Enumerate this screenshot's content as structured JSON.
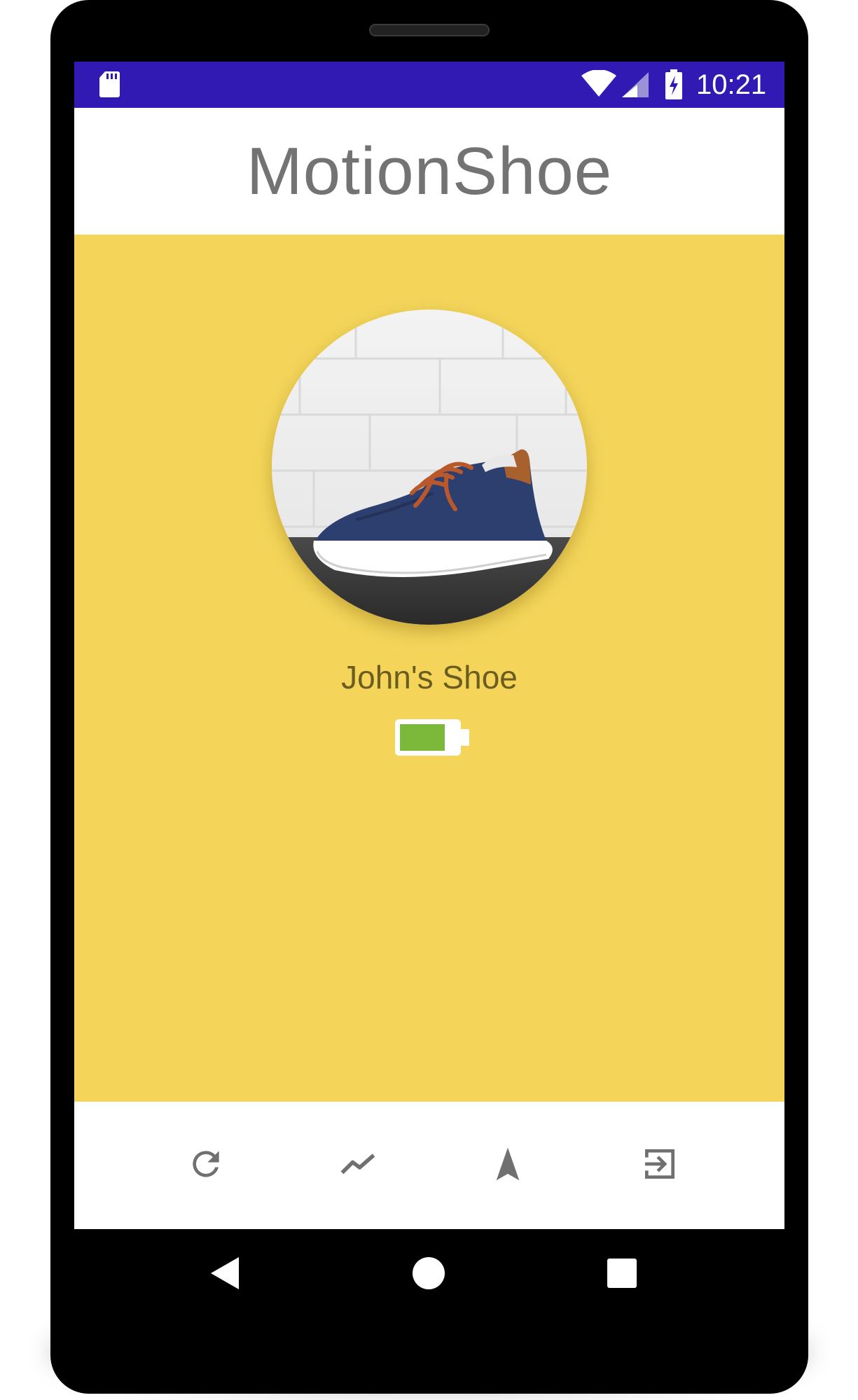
{
  "status_bar": {
    "time": "10:21",
    "icons": [
      "sd-card-icon",
      "wifi-icon",
      "cell-signal-icon",
      "battery-charging-icon"
    ]
  },
  "app": {
    "title": "MotionShoe"
  },
  "device": {
    "name": "John's Shoe",
    "battery_level": 0.8,
    "battery_color": "#7cb83a"
  },
  "bottom_nav": {
    "actions": [
      "refresh-icon",
      "trending-icon",
      "navigation-icon",
      "exit-icon"
    ]
  },
  "system_nav": {
    "buttons": [
      "back-icon",
      "home-icon",
      "recents-icon"
    ]
  },
  "colors": {
    "status_bar": "#311ab4",
    "content_background": "#f4d55a",
    "title_text": "#737373",
    "icon_gray": "#707070"
  }
}
